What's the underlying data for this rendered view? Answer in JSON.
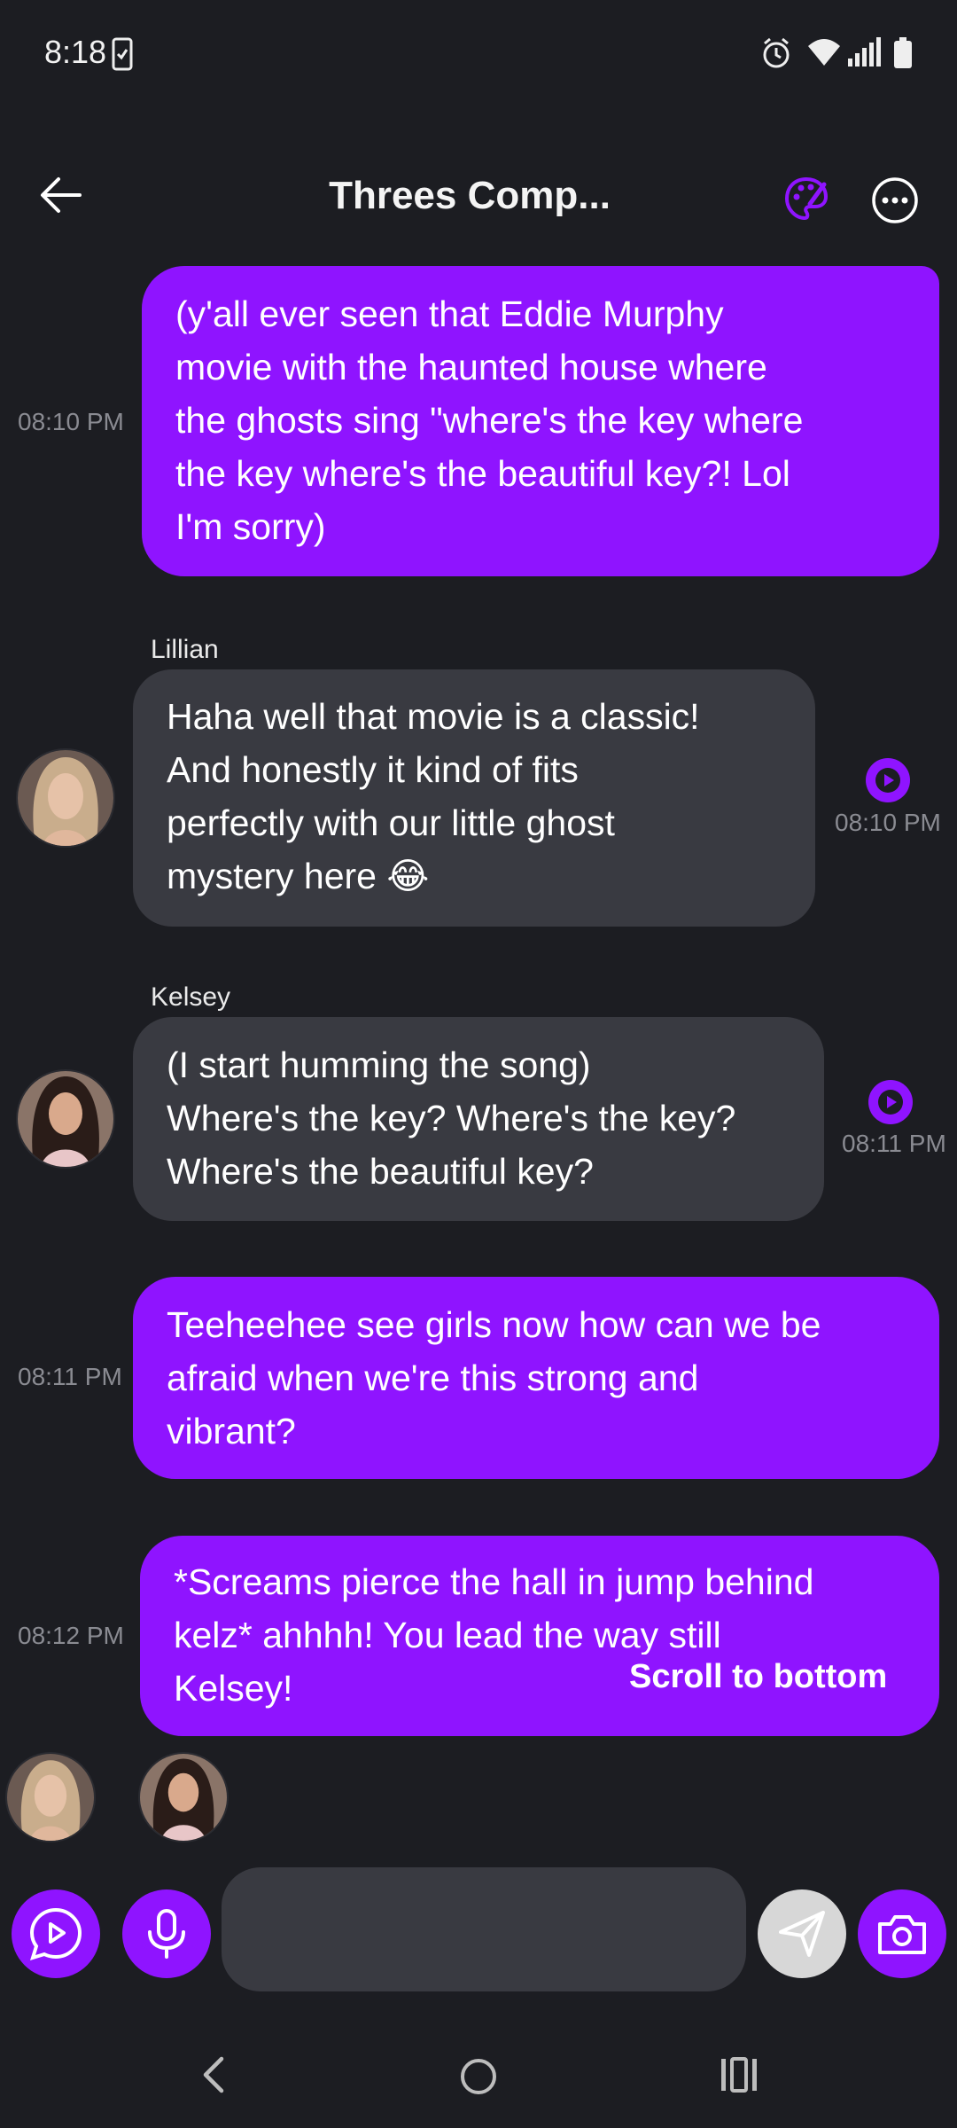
{
  "status_bar": {
    "time": "8:18"
  },
  "header": {
    "title": "Threes Comp..."
  },
  "messages": [
    {
      "time": "08:10 PM",
      "text": "(y'all ever seen that Eddie Murphy\nmovie with the haunted house where\nthe ghosts sing \"where's the key where\nthe key where's the beautiful key?! Lol\nI'm sorry)"
    },
    {
      "sender": "Lillian",
      "time": "08:10 PM",
      "text": "Haha well that movie is a classic!\nAnd honestly it kind of fits\nperfectly with our little ghost\nmystery here 😂"
    },
    {
      "sender": "Kelsey",
      "time": "08:11 PM",
      "text": "(I start humming the song)\nWhere's the key? Where's the key?\nWhere's the beautiful key?"
    },
    {
      "time": "08:11 PM",
      "text": "Teeheehee see girls now how can we be\nafraid when we're this strong and\nvibrant?"
    },
    {
      "time": "08:12 PM",
      "text": "*Screams pierce the hall in jump behind\nkelz* ahhhh! You lead the way still\nKelsey!"
    }
  ],
  "scroll_to_bottom": "Scroll to bottom",
  "composer": {
    "value": "",
    "placeholder": ""
  },
  "colors": {
    "accent": "#8f14ff",
    "background": "#1c1d22",
    "ai_bubble": "#393a41"
  }
}
